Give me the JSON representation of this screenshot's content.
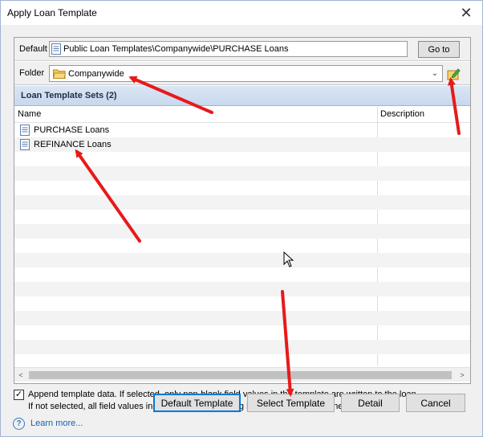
{
  "window": {
    "title": "Apply Loan Template",
    "close_glyph": "✕"
  },
  "default_row": {
    "label": "Default",
    "path": "Public Loan Templates\\Companywide\\PURCHASE Loans",
    "goto_label": "Go to"
  },
  "folder_row": {
    "label": "Folder",
    "value": "Companywide",
    "arrow": "⌄"
  },
  "sets": {
    "header": "Loan Template Sets (2)",
    "columns": [
      "Name",
      "Description"
    ],
    "items": [
      {
        "name": "PURCHASE Loans",
        "description": ""
      },
      {
        "name": "REFINANCE Loans",
        "description": ""
      }
    ]
  },
  "append": {
    "checked": true,
    "check_glyph": "✓",
    "line1": "Append template data. If selected, only non-blank field values in the template are written to the loan.",
    "line2": "If not selected, all field values in the template (including blanks) are written to the loan."
  },
  "buttons": {
    "default_template": "Default Template",
    "select_template": "Select Template",
    "detail": "Detail",
    "cancel": "Cancel"
  },
  "scroll": {
    "left_glyph": "<",
    "right_glyph": ">"
  },
  "help": {
    "glyph": "?",
    "link": "Learn more..."
  },
  "icons": {
    "close": "close-icon",
    "document": "document-icon",
    "folder": "folder-icon",
    "edit_folder": "edit-folder-icon",
    "help": "help-icon",
    "cursor": "mouse-cursor-icon"
  },
  "colors": {
    "accent": "#0078d7",
    "header_band": "#c7d8ee",
    "annotation_arrow": "#e8191a",
    "link": "#1a5fb4"
  }
}
